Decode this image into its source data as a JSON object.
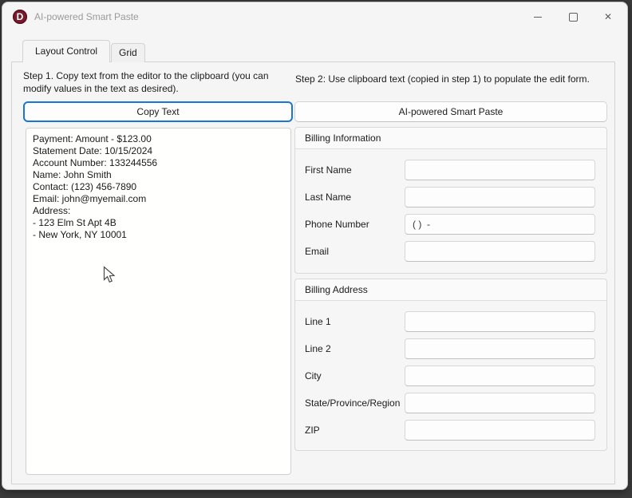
{
  "window": {
    "title": "AI-powered Smart Paste",
    "logo_letter": "D"
  },
  "icons": {
    "minimize": "–",
    "maximize": "▢",
    "close": "✕"
  },
  "tabs": [
    {
      "label": "Layout Control",
      "active": true
    },
    {
      "label": "Grid",
      "active": false
    }
  ],
  "left_panel": {
    "step_text": "Step 1. Copy text from the editor to the clipboard (you can modify values in the text as desired).",
    "copy_button_label": "Copy Text",
    "editor_lines": [
      "Payment: Amount - $123.00",
      "Statement Date: 10/15/2024",
      "Account Number: 133244556",
      "Name: John Smith",
      "Contact: (123) 456-7890",
      "Email: john@myemail.com",
      "Address:",
      "- 123 Elm St Apt 4B",
      "- New York, NY 10001"
    ]
  },
  "right_panel": {
    "step_text": "Step 2: Use clipboard text (copied in step 1) to populate the edit form.",
    "paste_button_label": "AI-powered Smart Paste",
    "groups": [
      {
        "title": "Billing Information",
        "fields": [
          {
            "label": "First Name",
            "value": ""
          },
          {
            "label": "Last Name",
            "value": ""
          },
          {
            "label": "Phone Number",
            "value": "( )  -"
          },
          {
            "label": "Email",
            "value": ""
          }
        ]
      },
      {
        "title": "Billing Address",
        "fields": [
          {
            "label": "Line 1",
            "value": ""
          },
          {
            "label": "Line 2",
            "value": ""
          },
          {
            "label": "City",
            "value": ""
          },
          {
            "label": "State/Province/Region",
            "value": ""
          },
          {
            "label": "ZIP",
            "value": ""
          }
        ]
      }
    ]
  },
  "colors": {
    "accent_blue": "#1976d2",
    "logo_red": "#7a1b2d",
    "window_bg": "#f5f5f5"
  }
}
